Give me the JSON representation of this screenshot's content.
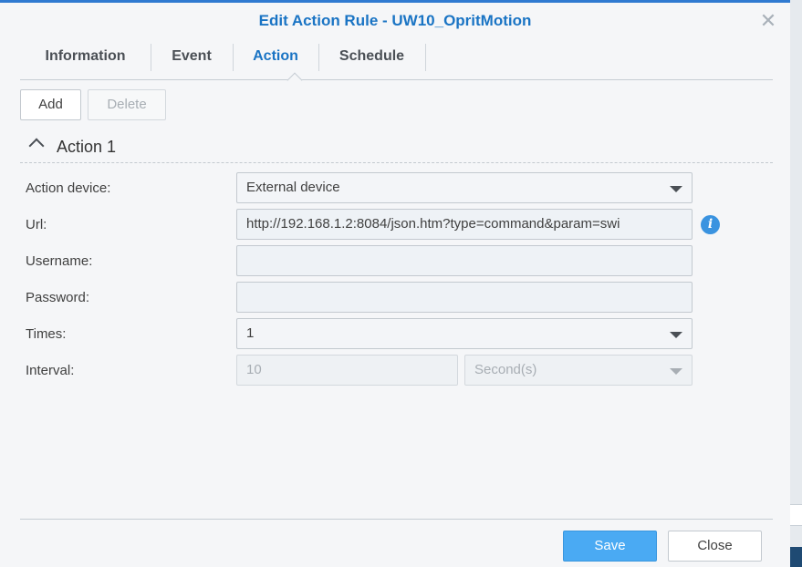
{
  "dialog": {
    "title": "Edit Action Rule - UW10_OpritMotion",
    "close_icon": "close-icon"
  },
  "tabs": [
    {
      "label": "Information"
    },
    {
      "label": "Event"
    },
    {
      "label": "Action",
      "active": true
    },
    {
      "label": "Schedule"
    }
  ],
  "toolbar": {
    "add_label": "Add",
    "delete_label": "Delete"
  },
  "section": {
    "title": "Action 1",
    "icon": "chevron-up-icon"
  },
  "form": {
    "action_device": {
      "label": "Action device:",
      "value": "External device"
    },
    "url": {
      "label": "Url:",
      "value": "http://192.168.1.2:8084/json.htm?type=command&param=swi"
    },
    "username": {
      "label": "Username:",
      "value": ""
    },
    "password": {
      "label": "Password:",
      "value": ""
    },
    "times": {
      "label": "Times:",
      "value": "1"
    },
    "interval": {
      "label": "Interval:",
      "value": "10",
      "unit": "Second(s)"
    }
  },
  "footer": {
    "save_label": "Save",
    "close_label": "Close"
  },
  "colors": {
    "accent": "#1a74c4",
    "save_button": "#4aaaf3",
    "info_icon": "#3a93e0"
  }
}
